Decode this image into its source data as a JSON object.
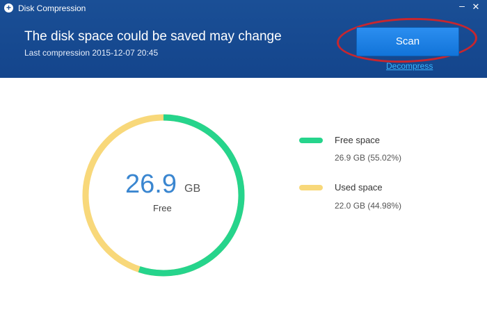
{
  "window": {
    "title": "Disk Compression",
    "minimize_glyph": "–",
    "close_glyph": "✕"
  },
  "header": {
    "headline": "The disk space could be saved may change",
    "last_compression": "Last compression 2015-12-07 20:45",
    "scan_label": "Scan",
    "decompress_label": "Decompress"
  },
  "summary": {
    "value": "26.9",
    "unit": "GB",
    "caption": "Free"
  },
  "legend": {
    "free": {
      "label": "Free space",
      "detail": "26.9 GB   (55.02%)"
    },
    "used": {
      "label": "Used space",
      "detail": "22.0 GB   (44.98%)"
    }
  },
  "chart_data": {
    "type": "pie",
    "style": "donut",
    "slices": [
      {
        "label": "Free space",
        "value": 55.02
      },
      {
        "label": "Used space",
        "value": 44.98
      }
    ]
  },
  "colors": {
    "header_bg": "#1a4f96",
    "free": "#26d48c",
    "used": "#f8d87a",
    "accent_button": "#1e84e6",
    "highlight_ring": "#c8262e"
  }
}
